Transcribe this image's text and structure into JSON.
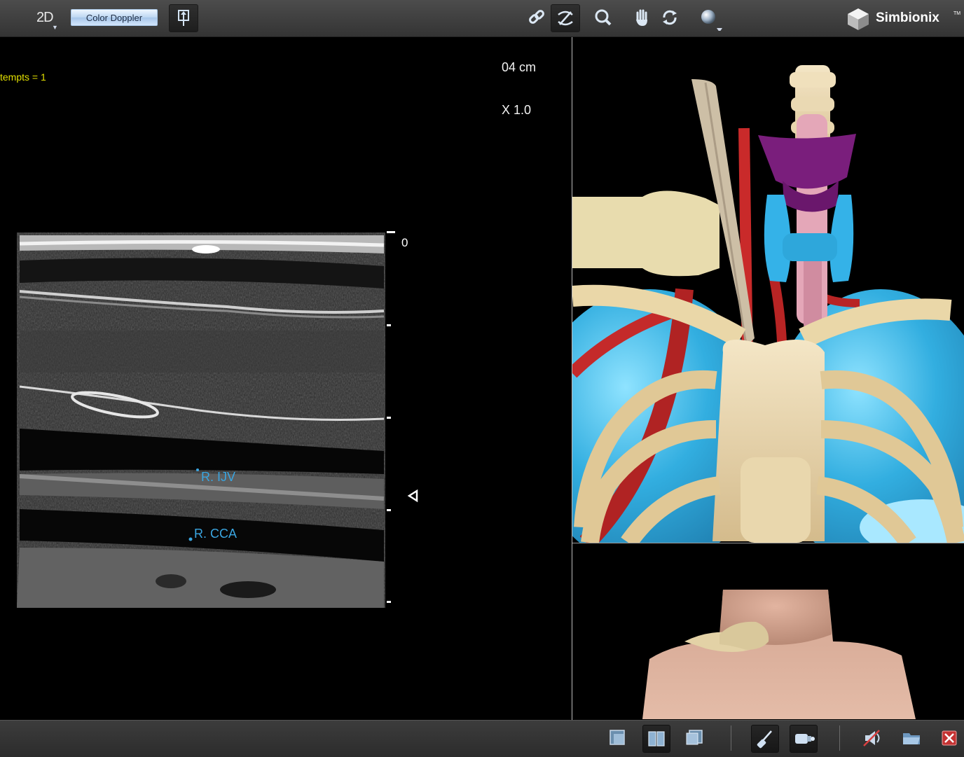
{
  "toolbar": {
    "mode_label": "2D",
    "doppler_button": "Color Doppler",
    "icons": [
      "probe-marker-icon",
      "link-icon",
      "probe-rotate-icon",
      "magnify-icon",
      "pan-hand-icon",
      "rotate-icon",
      "light-sphere-icon"
    ]
  },
  "brand": {
    "name": "Simbionix",
    "trademark": "TM"
  },
  "ultrasound": {
    "attempts_text": "tempts = 1",
    "depth_text": "04 cm",
    "zoom_text": "X 1.0",
    "scale_zero": "0",
    "vessel_labels": {
      "ijv": "R. IJV",
      "cca": "R. CCA"
    }
  },
  "bottom_icons": [
    "layout-single-icon",
    "layout-split-icon",
    "layout-overlap-icon",
    "needle-tool-icon",
    "probe-tool-icon",
    "sound-icon",
    "folder-icon",
    "close-icon"
  ],
  "colors": {
    "attempts": "#e3e000",
    "vessel_label": "#3aa5e0",
    "accent": "#a7c6ea"
  }
}
